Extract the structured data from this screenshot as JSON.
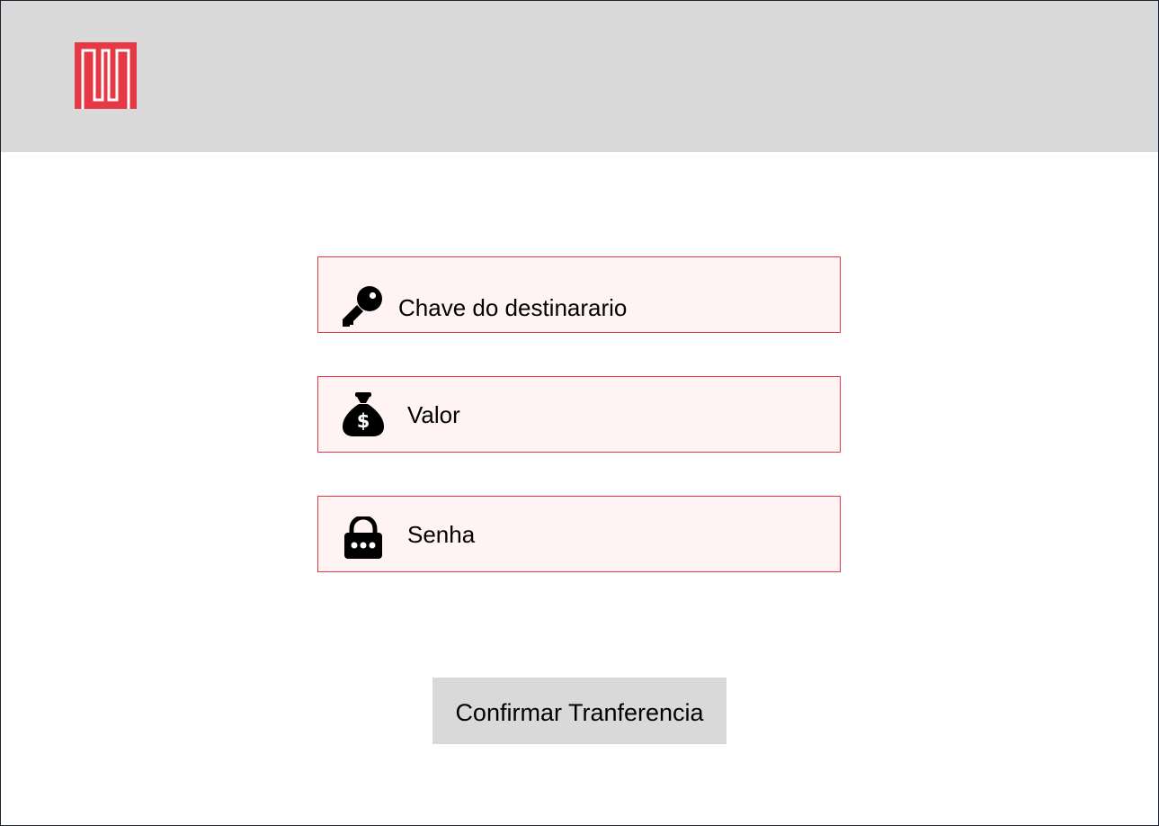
{
  "colors": {
    "accent": "#e53946",
    "header_bg": "#d9d9d9",
    "field_bg": "#fff3f3",
    "button_bg": "#d9d9d9"
  },
  "header": {
    "logo_icon": "brand-logo-icon"
  },
  "form": {
    "fields": [
      {
        "icon": "key-icon",
        "placeholder": "Chave do destinarario"
      },
      {
        "icon": "money-bag-icon",
        "placeholder": "Valor"
      },
      {
        "icon": "lock-icon",
        "placeholder": "Senha"
      }
    ],
    "confirm_label": "Confirmar Tranferencia"
  }
}
